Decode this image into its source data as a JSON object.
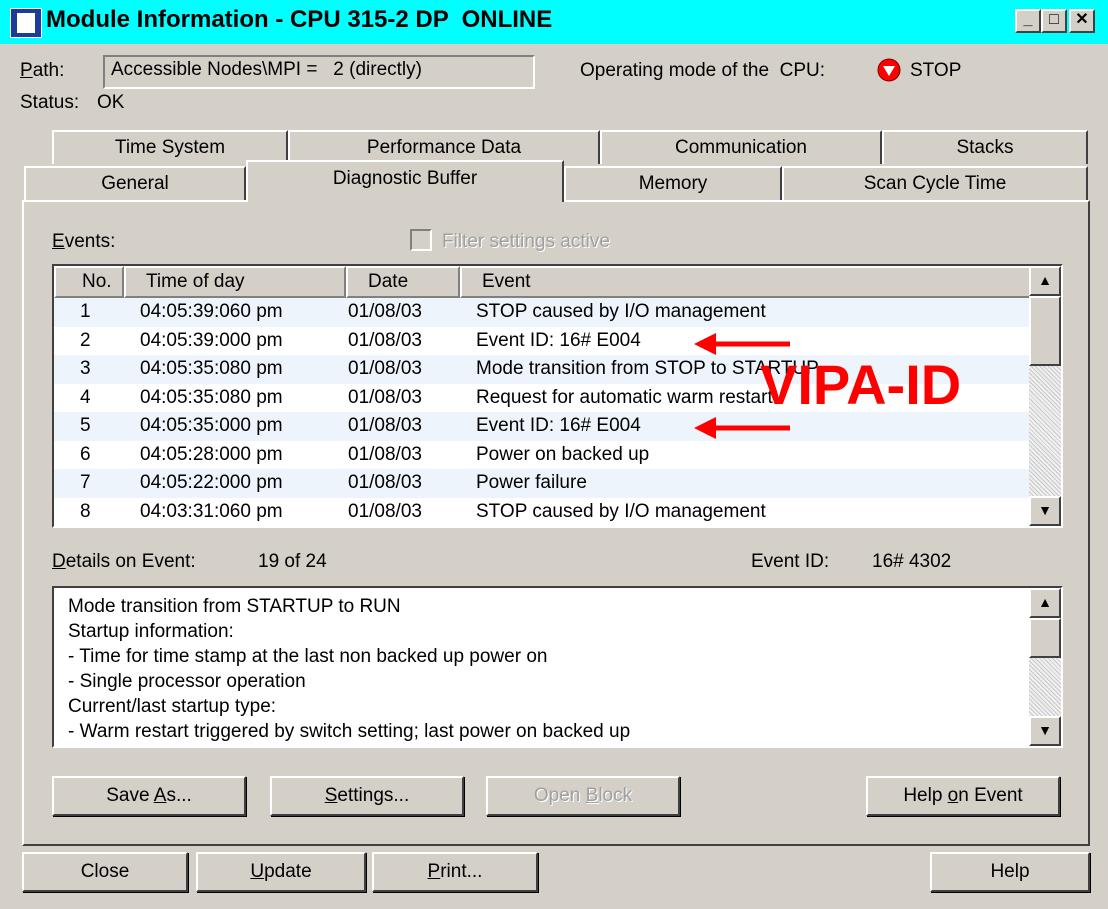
{
  "window": {
    "title": "Module Information - CPU 315-2 DP  ONLINE"
  },
  "path": {
    "label": "Path:",
    "value": "Accessible Nodes\\MPI =   2 (directly)"
  },
  "opmode": {
    "label": "Operating mode of the  CPU:",
    "value": "STOP"
  },
  "status": {
    "label": "Status:",
    "value": "OK"
  },
  "tabs_back": [
    "Time System",
    "Performance Data",
    "Communication",
    "Stacks"
  ],
  "tabs_front": [
    "General",
    "Diagnostic Buffer",
    "Memory",
    "Scan Cycle Time"
  ],
  "events": {
    "label": "Events:",
    "filter_label": "Filter settings active",
    "columns": [
      "No.",
      "Time of day",
      "Date",
      "Event"
    ],
    "rows": [
      {
        "no": "1",
        "time": "04:05:39:060 pm",
        "date": "01/08/03",
        "event": "STOP caused by I/O management"
      },
      {
        "no": "2",
        "time": "04:05:39:000 pm",
        "date": "01/08/03",
        "event": "Event ID: 16# E004"
      },
      {
        "no": "3",
        "time": "04:05:35:080 pm",
        "date": "01/08/03",
        "event": "Mode transition from STOP to STARTUP"
      },
      {
        "no": "4",
        "time": "04:05:35:080 pm",
        "date": "01/08/03",
        "event": "Request for automatic warm restart"
      },
      {
        "no": "5",
        "time": "04:05:35:000 pm",
        "date": "01/08/03",
        "event": "Event ID: 16# E004"
      },
      {
        "no": "6",
        "time": "04:05:28:000 pm",
        "date": "01/08/03",
        "event": "Power on backed up"
      },
      {
        "no": "7",
        "time": "04:05:22:000 pm",
        "date": "01/08/03",
        "event": "Power failure"
      },
      {
        "no": "8",
        "time": "04:03:31:060 pm",
        "date": "01/08/03",
        "event": "STOP caused by I/O management"
      }
    ]
  },
  "annotation": "VIPA-ID",
  "details": {
    "label": "Details on Event:",
    "counter": "19 of 24",
    "event_id_label": "Event ID:",
    "event_id": "16# 4302",
    "lines": [
      "Mode transition from STARTUP to RUN",
      "Startup information:",
      "- Time for time stamp at the last non backed up power on",
      "- Single processor operation",
      "Current/last startup type:",
      "- Warm restart triggered by switch setting; last power on backed up"
    ]
  },
  "buttons": {
    "save_as": "Save As...",
    "settings": "Settings...",
    "open_block": "Open Block",
    "help_on_event": "Help on Event",
    "close": "Close",
    "update": "Update",
    "print": "Print...",
    "help": "Help"
  },
  "colors": {
    "titlebar": "#00ffff",
    "stop_icon": "#ff0000",
    "annotation": "#ff0000",
    "row_alt": "#eef4fb"
  }
}
